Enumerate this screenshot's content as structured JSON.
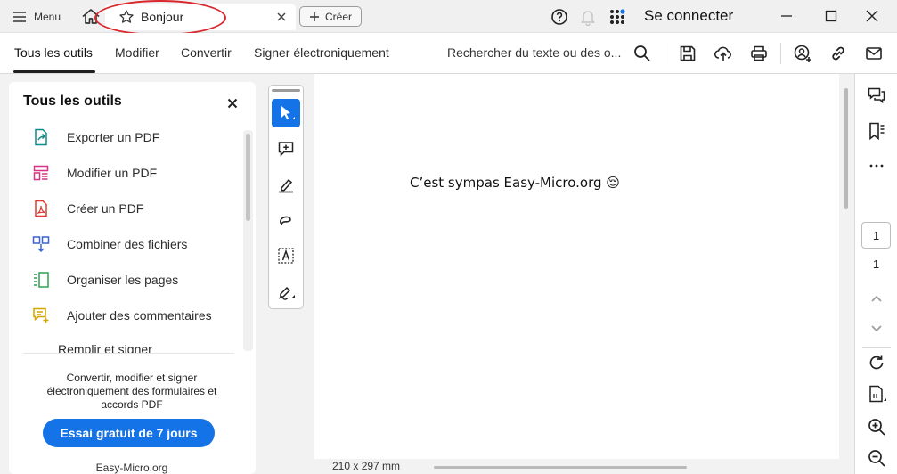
{
  "titlebar": {
    "menu_label": "Menu",
    "tab_title": "Bonjour",
    "create_label": "Créer",
    "signin_label": "Se connecter",
    "icons": [
      "hamburger-icon",
      "home-icon",
      "star-icon",
      "close-icon",
      "plus-icon",
      "help-icon",
      "bell-icon",
      "apps-icon",
      "minimize-icon",
      "maximize-icon",
      "close-window-icon"
    ],
    "notification_dot_color": "#1473e6",
    "annotation_color": "#d9262b"
  },
  "toolbar": {
    "tabs": [
      {
        "label": "Tous les outils",
        "active": true
      },
      {
        "label": "Modifier"
      },
      {
        "label": "Convertir"
      },
      {
        "label": "Signer électroniquement"
      }
    ],
    "search_text": "Rechercher du texte ou des o...",
    "icons": [
      "search-icon",
      "save-icon",
      "upload-cloud-icon",
      "print-icon",
      "share-user-icon",
      "link-icon",
      "mail-icon"
    ]
  },
  "left_panel": {
    "title": "Tous les outils",
    "tools": [
      {
        "label": "Exporter un PDF",
        "icon": "export-pdf-icon",
        "color": "#0d8a8a"
      },
      {
        "label": "Modifier un PDF",
        "icon": "edit-pdf-icon",
        "color": "#d63384"
      },
      {
        "label": "Créer un PDF",
        "icon": "create-pdf-icon",
        "color": "#e03a2f"
      },
      {
        "label": "Combiner des fichiers",
        "icon": "combine-files-icon",
        "color": "#3b63d1"
      },
      {
        "label": "Organiser les pages",
        "icon": "organize-pages-icon",
        "color": "#2aa44a"
      },
      {
        "label": "Ajouter des commentaires",
        "icon": "add-comment-icon",
        "color": "#d6a400"
      }
    ],
    "partial_item": "Remplir et signer",
    "promo_text": "Convertir, modifier et signer électroniquement des formulaires et accords PDF",
    "trial_button": "Essai gratuit de 7 jours",
    "footer": "Easy-Micro.org",
    "accent_color": "#1473e6"
  },
  "tool_strip": {
    "tools": [
      "select-cursor-icon",
      "add-comment-icon",
      "highlight-pen-icon",
      "freehand-draw-icon",
      "text-select-icon",
      "sign-pen-icon"
    ],
    "active_index": 0
  },
  "document": {
    "text": "C’est sympas Easy-Micro.org 😌",
    "page_size": "210 x 297 mm"
  },
  "right_rail": {
    "current_page": "1",
    "total_pages": "1",
    "icons": [
      "comments-icon",
      "bookmark-icon",
      "more-icon",
      "page-up-icon",
      "page-down-icon",
      "rotate-icon",
      "page-fit-icon",
      "zoom-in-icon",
      "zoom-out-icon"
    ]
  }
}
